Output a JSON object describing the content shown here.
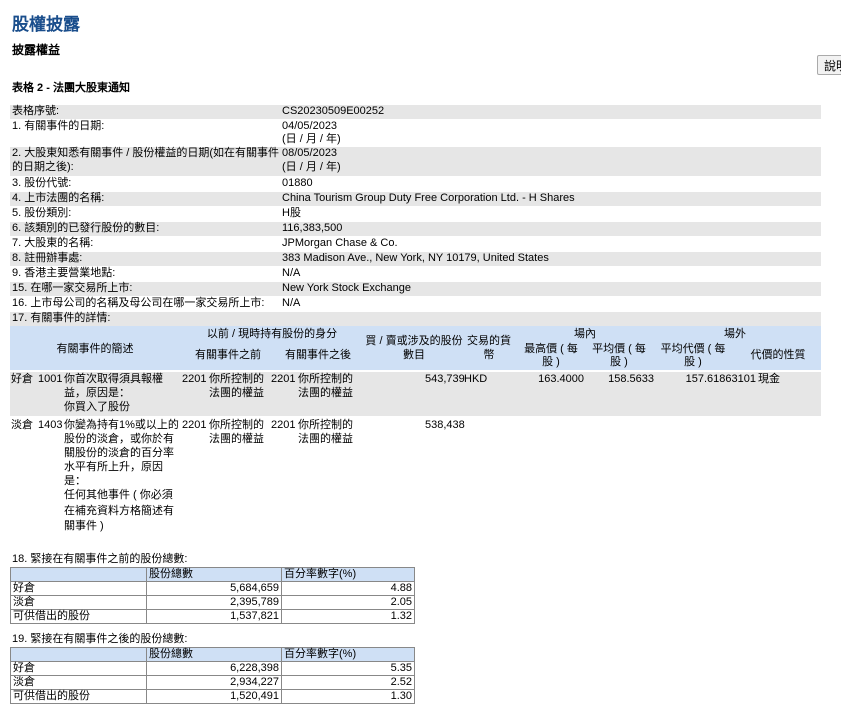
{
  "page": {
    "title": "股權披露",
    "subtitle": "披露權益",
    "form_title": "表格 2 - 法團大股東通知",
    "help_button": "說明"
  },
  "fields": [
    {
      "label": "表格序號:",
      "value": "CS20230509E00252"
    },
    {
      "label": "1. 有關事件的日期:",
      "value": "04/05/2023",
      "note": "(日 / 月 / 年)"
    },
    {
      "label": "2. 大股東知悉有關事件 / 股份權益的日期(如在有關事件的日期之後):",
      "label_line1": "2. 大股東知悉有關事件 / 股份權益的日期(如在有關事件",
      "label_line2": "的日期之後):",
      "value": "08/05/2023",
      "note": "(日 / 月 / 年)"
    },
    {
      "label": "3. 股份代號:",
      "value": "01880"
    },
    {
      "label": "4. 上市法團的名稱:",
      "value": "China Tourism Group Duty Free Corporation Ltd. - H Shares"
    },
    {
      "label": "5. 股份類別:",
      "value": "H股"
    },
    {
      "label": "6. 該類別的已發行股份的數目:",
      "value": "116,383,500"
    },
    {
      "label": "7. 大股東的名稱:",
      "value": "JPMorgan Chase & Co."
    },
    {
      "label": "8. 註冊辦事處:",
      "value": "383 Madison Ave., New York, NY 10179, United States"
    },
    {
      "label": "9. 香港主要營業地點:",
      "value": "N/A"
    },
    {
      "label": "15. 在哪一家交易所上市:",
      "value": "New York Stock Exchange"
    },
    {
      "label": "16. 上市母公司的名稱及母公司在哪一家交易所上市:",
      "value": "N/A"
    },
    {
      "label": "17. 有關事件的詳情:",
      "value": ""
    }
  ],
  "event_table": {
    "headers": {
      "event": "有關事件的簡述",
      "capacity_group": "以前 / 現時持有股份的身分",
      "before": "有關事件之前",
      "after": "有關事件之後",
      "shares_line1": "買 / 賣或涉及的股份",
      "shares_line2": "數目",
      "currency_line1": "交易的貨",
      "currency_line2": "幣",
      "onex_group": "場內",
      "high_line1": "最高價 ( 每",
      "high_line2": "股 )",
      "avg_line1": "平均價 ( 每",
      "avg_line2": "股 )",
      "offex_group": "場外",
      "offavg_line1": "平均代價 ( 每",
      "offavg_line2": "股 )",
      "consideration": "代價的性質"
    },
    "rows": [
      {
        "position": "好倉",
        "code": "1001",
        "desc_lines": [
          "你首次取得須具報權",
          "益，原因是：",
          "你買入了股份"
        ],
        "before_code": "2201",
        "before_lines": [
          "你所控制的",
          "法團的權益"
        ],
        "after_code": "2201",
        "after_lines": [
          "你所控制的",
          "法團的權益"
        ],
        "shares": "543,739",
        "currency": "HKD",
        "high": "163.4000",
        "avg": "158.5633",
        "off_avg": "157.61863101",
        "consideration": "現金"
      },
      {
        "position": "淡倉",
        "code": "1403",
        "desc_lines": [
          "你變為持有1%或以上的",
          "股份的淡倉，或你於有",
          "關股份的淡倉的百分率",
          "水平有所上升，原因",
          "是：",
          "任何其他事件 ( 你必須",
          "在補充資料方格簡述有",
          "關事件 )"
        ],
        "before_code": "2201",
        "before_lines": [
          "你所控制的",
          "法團的權益"
        ],
        "after_code": "2201",
        "after_lines": [
          "你所控制的",
          "法團的權益"
        ],
        "shares": "538,438",
        "currency": "",
        "high": "",
        "avg": "",
        "off_avg": "",
        "consideration": ""
      }
    ]
  },
  "section18": {
    "title": "18. 緊接在有關事件之前的股份總數:",
    "col_shares": "股份總數",
    "col_pct": "百分率數字(%)",
    "rows": [
      {
        "label": "好倉",
        "shares": "5,684,659",
        "pct": "4.88"
      },
      {
        "label": "淡倉",
        "shares": "2,395,789",
        "pct": "2.05"
      },
      {
        "label": "可供借出的股份",
        "shares": "1,537,821",
        "pct": "1.32"
      }
    ]
  },
  "section19": {
    "title": "19. 緊接在有關事件之後的股份總數:",
    "col_shares": "股份總數",
    "col_pct": "百分率數字(%)",
    "rows": [
      {
        "label": "好倉",
        "shares": "6,228,398",
        "pct": "5.35"
      },
      {
        "label": "淡倉",
        "shares": "2,934,227",
        "pct": "2.52"
      },
      {
        "label": "可供借出的股份",
        "shares": "1,520,491",
        "pct": "1.30"
      }
    ]
  },
  "colors": {
    "title": "#1a4e8c",
    "header_bg": "#cfe0f5",
    "row_shade": "#e6e6e6"
  }
}
